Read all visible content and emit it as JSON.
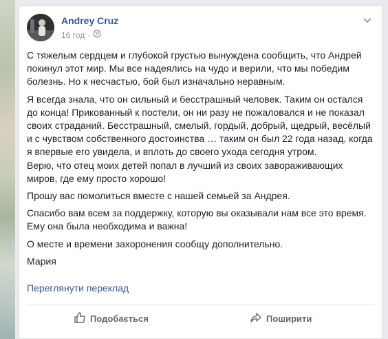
{
  "post": {
    "author": "Andrey Cruz",
    "time": "16 год",
    "dot": "·",
    "paragraphs": [
      "С тяжелым сердцем и глубокой грустью вынуждена сообщить, что Андрей покинул этот мир. Мы все надеялись на чудо и верили, что мы победим болезнь. Но к несчастью, бой был изначально неравным.",
      "Я всегда знала, что он сильный и бесстрашный человек. Таким он остался до конца! Прикованный к постели, он ни разу не пожаловался и не показал своих страданий. Бесстрашный, смелый, гордый, добрый, щедрый, весёлый и с чувством собственного достоинства … таким он был 22 года назад, когда я впервые его увидела, и вплоть до своего ухода сегодня утром.",
      "Верю, что отец моих детей попал в лучший из своих завораживающих миров, где ему просто хорошо!",
      "Прошу вас помолиться вместе с нашей семьей за Андрея.",
      "Спасибо вам всем за поддержку, которую вы оказывали нам все это время. Ему она была необходима и важна!",
      "О месте и времени захоронения сообщу дополнительно.",
      "Мария"
    ],
    "translate_link": "Переглянути переклад"
  },
  "actions": {
    "like_label": "Подобається",
    "share_label": "Поширити"
  }
}
